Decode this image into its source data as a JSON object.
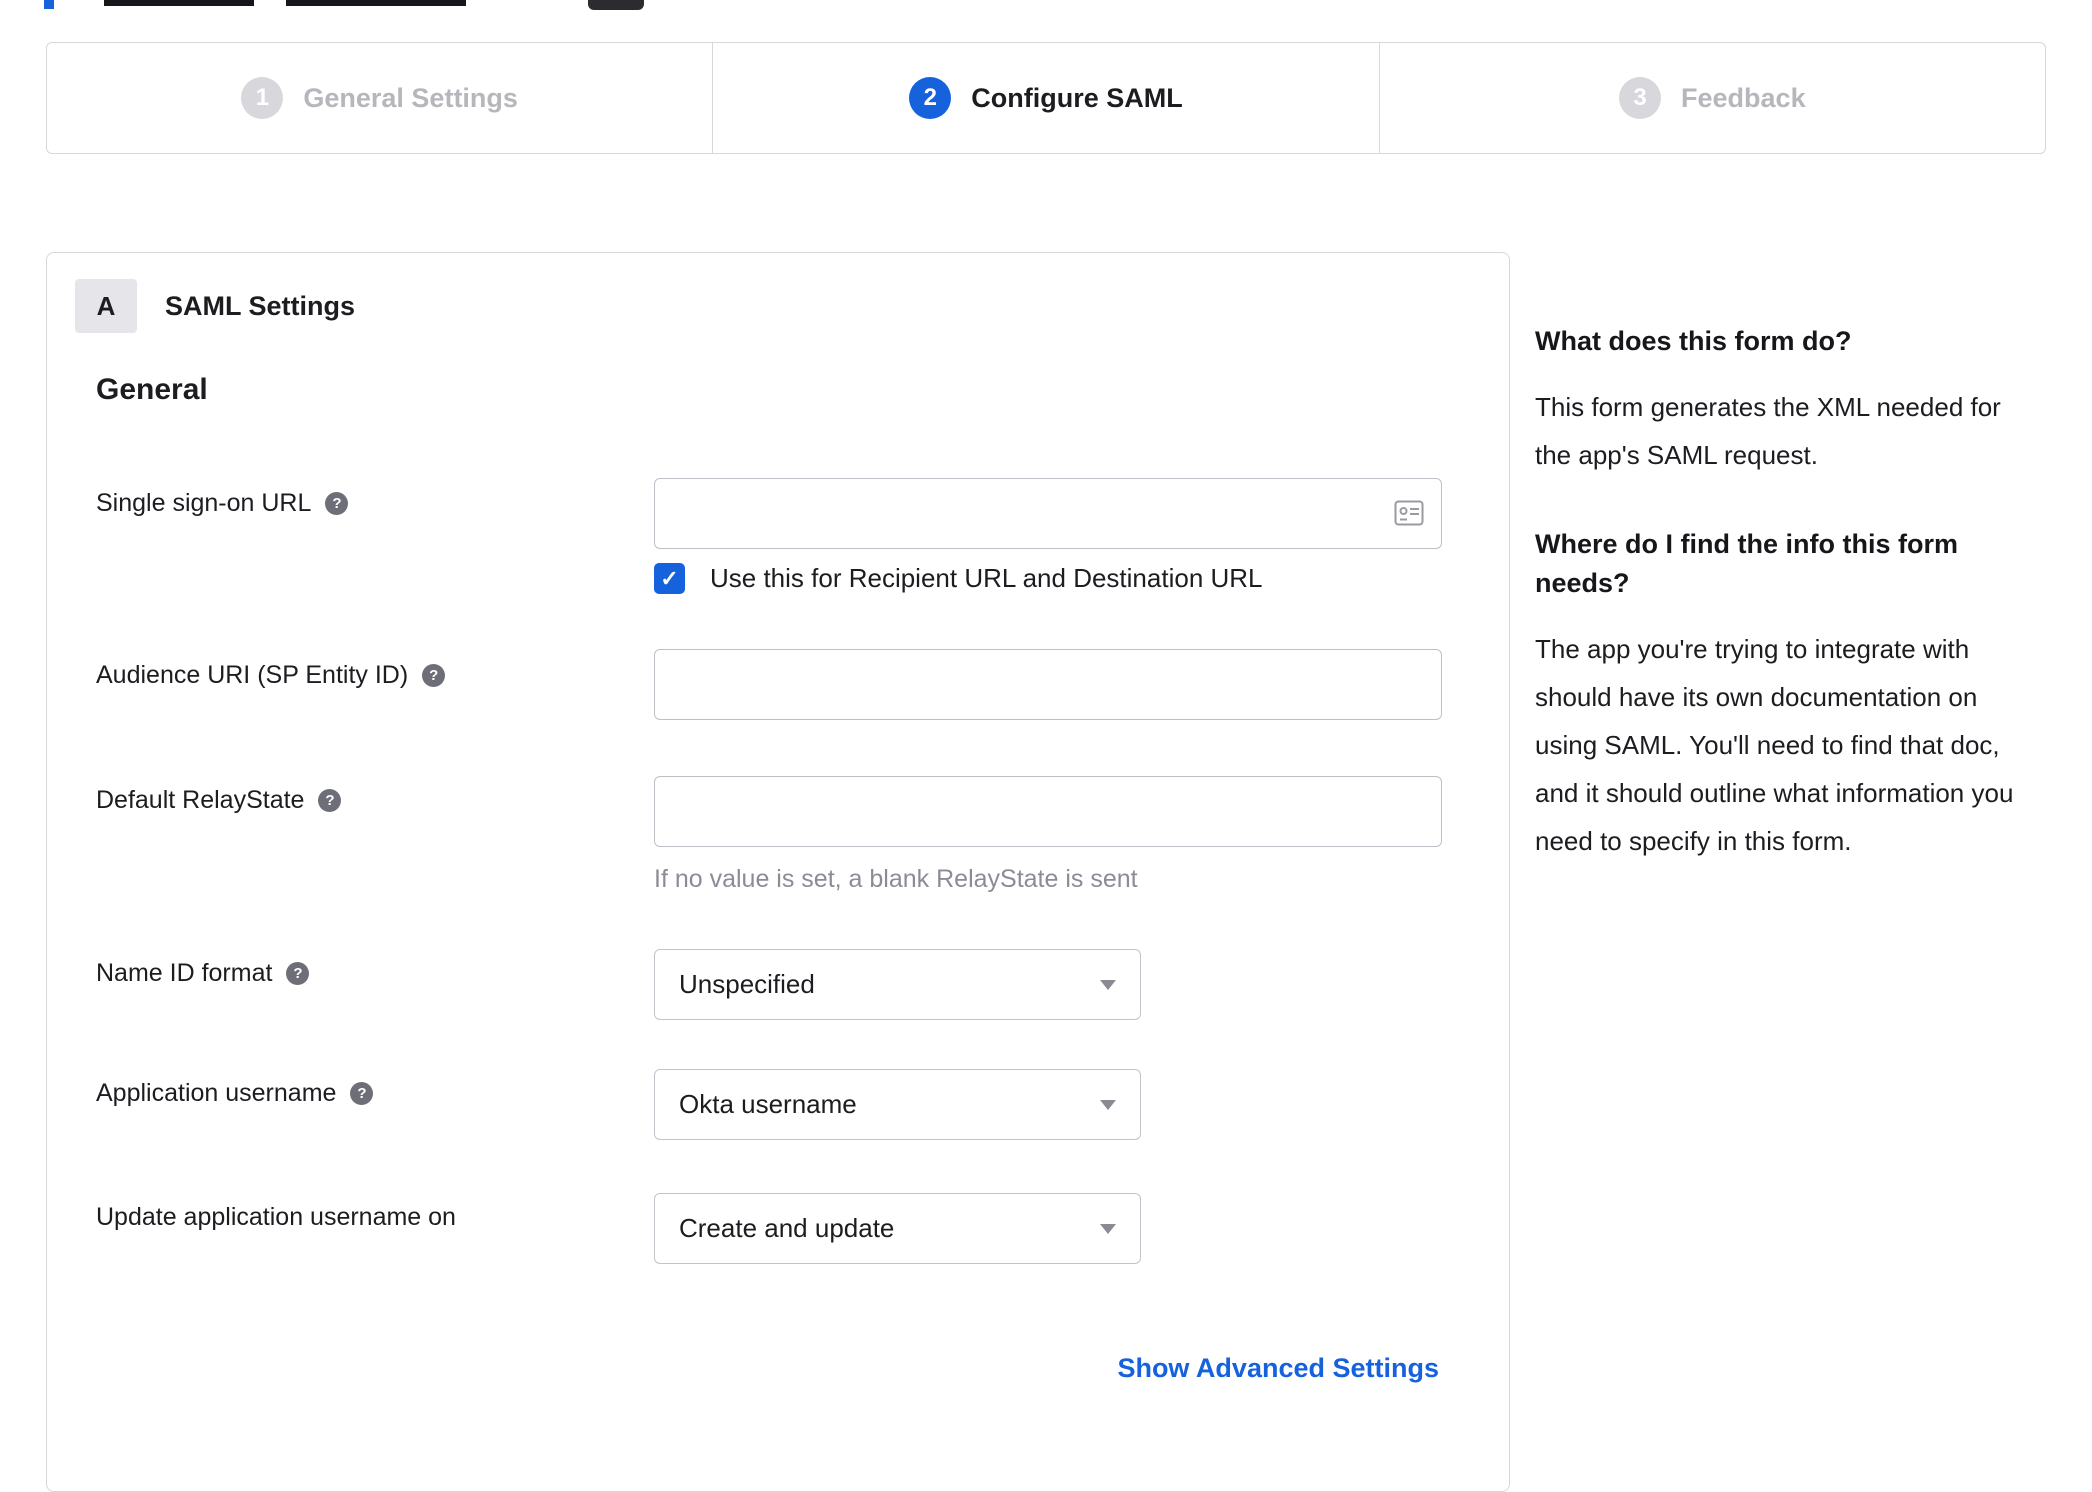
{
  "stepper": {
    "steps": [
      {
        "number": "1",
        "label": "General Settings",
        "state": "inactive"
      },
      {
        "number": "2",
        "label": "Configure SAML",
        "state": "active"
      },
      {
        "number": "3",
        "label": "Feedback",
        "state": "inactive"
      }
    ]
  },
  "panel": {
    "section_badge": "A",
    "section_title": "SAML Settings",
    "group_title": "General",
    "fields": {
      "sso_url": {
        "label": "Single sign-on URL",
        "value": ""
      },
      "sso_checkbox": {
        "label": "Use this for Recipient URL and Destination URL",
        "checked": true,
        "checkmark": "✓"
      },
      "audience_uri": {
        "label": "Audience URI (SP Entity ID)",
        "value": ""
      },
      "relay_state": {
        "label": "Default RelayState",
        "value": "",
        "help": "If no value is set, a blank RelayState is sent"
      },
      "name_id_format": {
        "label": "Name ID format",
        "value": "Unspecified"
      },
      "app_username": {
        "label": "Application username",
        "value": "Okta username"
      },
      "update_app_username": {
        "label": "Update application username on",
        "value": "Create and update"
      }
    },
    "help_glyph": "?",
    "advanced_link": "Show Advanced Settings"
  },
  "sidebar": {
    "q1": "What does this form do?",
    "a1": "This form generates the XML needed for the app's SAML request.",
    "q2": "Where do I find the info this form needs?",
    "a2": "The app you're trying to integrate with should have its own documentation on using SAML. You'll need to find that doc, and it should outline what information you need to specify in this form."
  },
  "colors": {
    "accent": "#1662dd",
    "inactive_text": "#b6b6bd",
    "border": "#d7d7dc"
  }
}
